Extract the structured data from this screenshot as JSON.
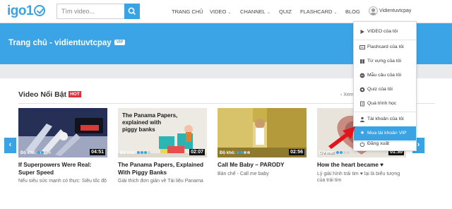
{
  "header": {
    "logo_text": "igo1",
    "search": {
      "placeholder": "Tìm video...",
      "value": ""
    },
    "nav": [
      {
        "label": "TRANG CHỦ",
        "has_caret": false
      },
      {
        "label": "VIDEO",
        "has_caret": true
      },
      {
        "label": "CHANNEL",
        "has_caret": true
      },
      {
        "label": "QUIZ",
        "has_caret": false
      },
      {
        "label": "FLASHCARD",
        "has_caret": true
      },
      {
        "label": "BLOG",
        "has_caret": false
      }
    ],
    "username": "Vidientuvtcpay",
    "caret": "⌄"
  },
  "banner": {
    "title": "Trang chủ - vidientuvtcpay",
    "vip": "VIP"
  },
  "section": {
    "title": "Video Nổi Bật",
    "hot": "HOT",
    "see_more": "Xem"
  },
  "cards": [
    {
      "level": "Độ khó:",
      "duration": "04:51",
      "title": "If Superpowers Were Real: Super Speed",
      "subtitle": "Nếu siêu sức mạnh có thực: Siêu tốc độ",
      "difficulty": 2
    },
    {
      "level": "Độ khó:",
      "duration": "02:07",
      "title": "The Panama Papers, Explained With Piggy Banks",
      "subtitle": "Giải thích đơn giản về Tài liệu Panama",
      "difficulty": 3,
      "thumb_text": [
        "The Panama Papers,",
        "explained with",
        "piggy banks"
      ]
    },
    {
      "level": "Độ khó:",
      "duration": "02:56",
      "title": "Call Me Baby – PARODY",
      "subtitle": "Bản chế - Call me baby",
      "difficulty": 2
    },
    {
      "level": "Độ khó:",
      "duration": "01:30",
      "title": "How the heart became ♥",
      "subtitle": "Lý giải hình trái tim ♥ lại là biểu tượng của trái tim",
      "difficulty": 2,
      "thumb_text": [
        "The heart"
      ]
    }
  ],
  "dropdown": {
    "items": [
      {
        "label": "VIDEO của tôi",
        "icon": "play-icon"
      },
      {
        "label": "Flashcard của tôi",
        "icon": "flashcard-icon"
      },
      {
        "label": "Từ vựng của tôi",
        "icon": "book-icon"
      },
      {
        "label": "Mẫu câu của tôi",
        "icon": "chat-icon"
      },
      {
        "label": "Quiz của tôi",
        "icon": "quiz-icon"
      },
      {
        "label": "Quá trình học",
        "icon": "progress-icon"
      },
      {
        "label": "Tài khoản của tôi",
        "icon": "user-icon"
      },
      {
        "label": "Mua tài khoản VIP",
        "icon": "star-icon",
        "active": true
      },
      {
        "label": "Đăng xuất",
        "icon": "power-icon"
      }
    ]
  },
  "colors": {
    "brand": "#3aa3e3",
    "banner": "#3ba4e6",
    "hot": "#e0303a",
    "annotation_arrow": "#e3121b"
  }
}
